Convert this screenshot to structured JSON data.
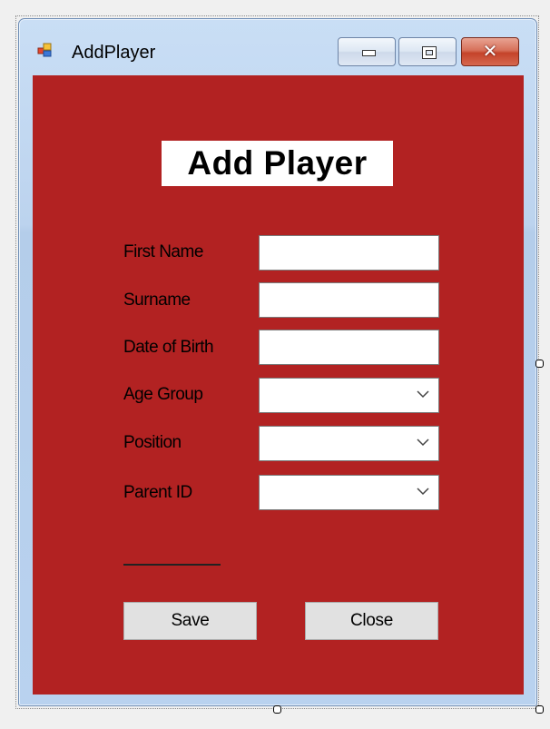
{
  "window": {
    "title": "AddPlayer",
    "close_glyph": "✕"
  },
  "form": {
    "heading": "Add Player",
    "fields": [
      {
        "label": "First Name",
        "type": "text",
        "value": ""
      },
      {
        "label": "Surname",
        "type": "text",
        "value": ""
      },
      {
        "label": "Date of Birth",
        "type": "text",
        "value": ""
      },
      {
        "label": "Age Group",
        "type": "combo",
        "value": ""
      },
      {
        "label": "Position",
        "type": "combo",
        "value": ""
      },
      {
        "label": "Parent ID",
        "type": "combo",
        "value": ""
      }
    ],
    "save_label": "Save",
    "close_label": "Close"
  },
  "colors": {
    "form_background": "#b22222",
    "button_face": "#e1e1e1"
  },
  "icons": {
    "app": "form-icon",
    "dropdown": "chevron-down-icon"
  }
}
